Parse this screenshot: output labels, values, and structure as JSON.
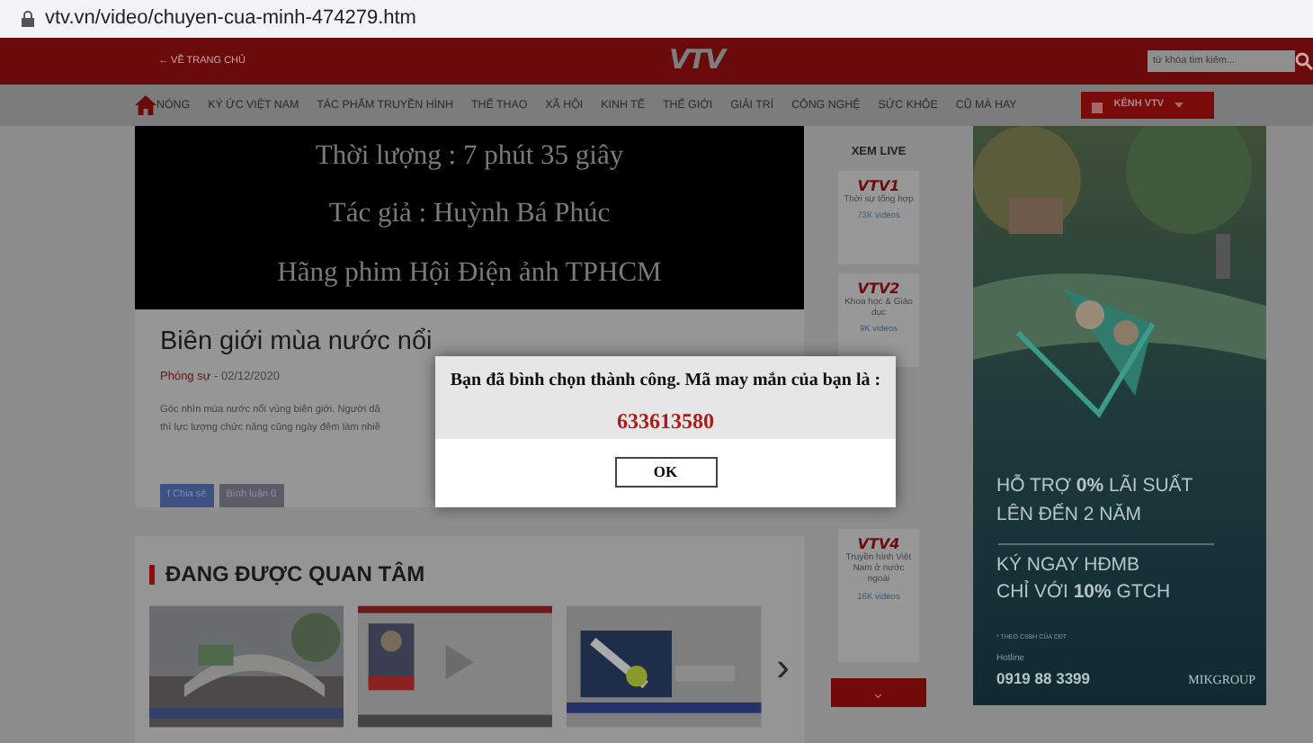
{
  "browser": {
    "url": "vtv.vn/video/chuyen-cua-minh-474279.htm"
  },
  "header": {
    "home_link": "← VỀ TRANG CHỦ",
    "logo": "VTV",
    "search": {
      "placeholder": "từ khóa tìm kiếm..."
    }
  },
  "nav": {
    "items": [
      "NÓNG",
      "KÝ ỨC VIỆT NAM",
      "TÁC PHẨM TRUYỀN HÌNH",
      "THỂ THAO",
      "XÃ HỘI",
      "KINH TẾ",
      "THẾ GIỚI",
      "GIẢI TRÍ",
      "CÔNG NGHỆ",
      "SỨC KHỎE",
      "CŨ MÀ HAY"
    ],
    "channel_button": "KÊNH VTV"
  },
  "video": {
    "lines": [
      "Thời lượng : 7 phút 35 giây",
      "Tác giả : Huỳnh Bá Phúc",
      "Hãng phim Hội Điện ảnh TPHCM"
    ]
  },
  "article": {
    "title": "Biên giới mùa nước nổi",
    "category": "Phóng sự",
    "date": "- 02/12/2020",
    "summary": [
      "Góc nhìn mùa nước nổi vùng biên giới. Người dâ",
      "thì lực lượng chức năng cũng ngày đêm làm nhiề"
    ],
    "share": "f  Chia sẻ",
    "comment": "Bình luận  0"
  },
  "section": {
    "title": "ĐANG ĐƯỢC QUAN TÂM",
    "next": "›"
  },
  "live": {
    "title": "XEM LIVE",
    "channels": [
      {
        "logo": "VTV1",
        "name": "Thời sự tổng hợp",
        "count": "73K videos"
      },
      {
        "logo": "VTV2",
        "name": "Khoa học & Giáo dục",
        "count": "9K videos"
      },
      {
        "logo": "VTV4",
        "name": "Truyền hình Việt Nam ở nước ngoài",
        "count": "16K videos"
      }
    ],
    "more": "⌄"
  },
  "ad": {
    "lines": [
      "HỖ TRỢ **0%** LÃI SUẤT",
      "LÊN ĐẾN 2 NĂM",
      "KÝ NGAY HĐMB",
      "CHỈ VỚI **10%** GTCH"
    ],
    "note": "* THEO CSBH CỦA CĐT",
    "hotline_label": "Hotline",
    "hotline": "0919 88 3399",
    "brand": "MIKGROUP"
  },
  "dialog": {
    "message": "Bạn đã bình chọn thành công. Mã may mắn của bạn là :",
    "code": "633613580",
    "button": "OK"
  }
}
